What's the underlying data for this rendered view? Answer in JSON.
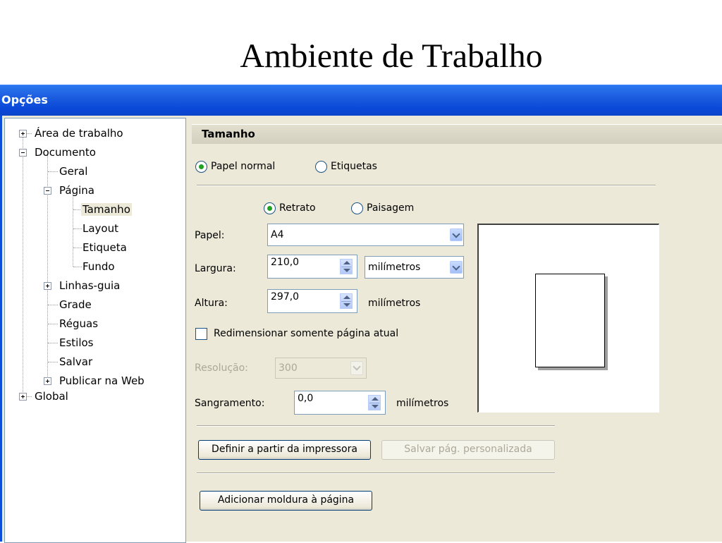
{
  "slide": {
    "title": "Ambiente de Trabalho"
  },
  "window": {
    "title": "Opções"
  },
  "tree": {
    "items": [
      {
        "label": "Área de trabalho"
      },
      {
        "label": "Documento"
      },
      {
        "label": "Geral"
      },
      {
        "label": "Página"
      },
      {
        "label": "Tamanho"
      },
      {
        "label": "Layout"
      },
      {
        "label": "Etiqueta"
      },
      {
        "label": "Fundo"
      },
      {
        "label": "Linhas-guia"
      },
      {
        "label": "Grade"
      },
      {
        "label": "Réguas"
      },
      {
        "label": "Estilos"
      },
      {
        "label": "Salvar"
      },
      {
        "label": "Publicar na Web"
      },
      {
        "label": "Global"
      }
    ],
    "selected": "Tamanho"
  },
  "panel": {
    "header": "Tamanho",
    "paper_type": {
      "normal": "Papel normal",
      "labels": "Etiquetas",
      "selected": "Papel normal"
    },
    "orientation": {
      "portrait": "Retrato",
      "landscape": "Paisagem",
      "selected": "Retrato"
    },
    "paper": {
      "label": "Papel:",
      "value": "A4"
    },
    "width": {
      "label": "Largura:",
      "value": "210,0",
      "unit": "milímetros"
    },
    "height": {
      "label": "Altura:",
      "value": "297,0",
      "unit": "milímetros"
    },
    "resize_current": {
      "label": "Redimensionar somente página atual",
      "checked": false
    },
    "resolution": {
      "label": "Resolução:",
      "value": "300"
    },
    "bleed": {
      "label": "Sangramento:",
      "value": "0,0",
      "unit": "milímetros"
    },
    "buttons": {
      "from_printer": "Definir a partir da impressora",
      "save_custom": "Salvar pág. personalizada",
      "add_frame": "Adicionar moldura à página"
    }
  },
  "colors": {
    "titlebar": "#0a48d8",
    "dialog_bg": "#ece9d8",
    "radio_selected": "#21a121"
  }
}
